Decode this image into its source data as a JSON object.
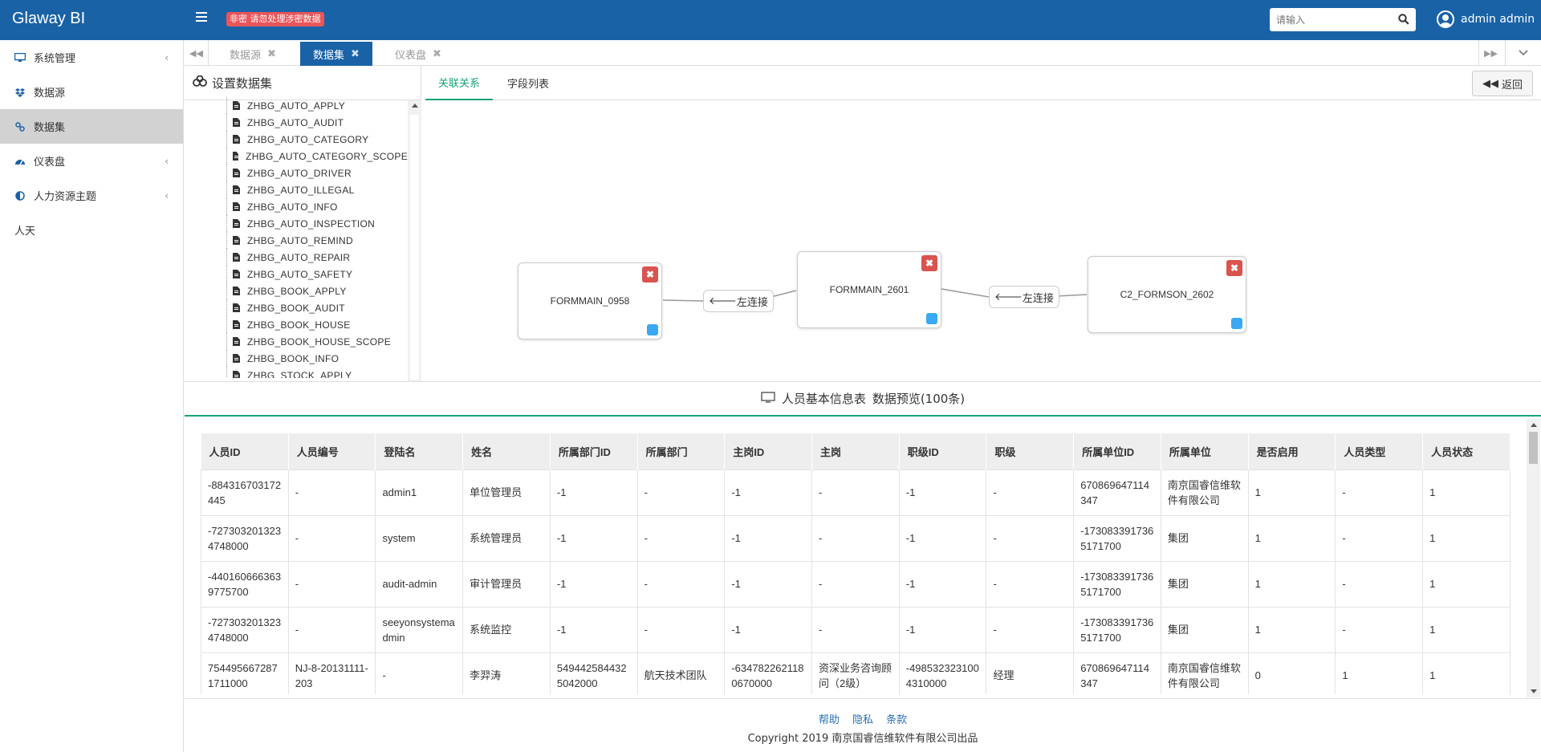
{
  "header": {
    "brand": "Glaway BI",
    "warning_badge": "非密 请忽处理涉密数据",
    "search_placeholder": "请输入",
    "user_name": "admin admin"
  },
  "sidebar": {
    "items": [
      {
        "label": "系统管理",
        "icon": "desktop-icon",
        "has_children": true
      },
      {
        "label": "数据源",
        "icon": "dropbox-icon",
        "has_children": false
      },
      {
        "label": "数据集",
        "icon": "link-icon",
        "has_children": false,
        "active": true
      },
      {
        "label": "仪表盘",
        "icon": "dashboard-icon",
        "has_children": true
      },
      {
        "label": "人力资源主题",
        "icon": "adjust-icon",
        "has_children": true
      },
      {
        "label": "人天",
        "icon": "",
        "has_children": false
      }
    ]
  },
  "tabs": [
    {
      "label": "数据源",
      "active": false
    },
    {
      "label": "数据集",
      "active": true
    },
    {
      "label": "仪表盘",
      "active": false
    }
  ],
  "tree": {
    "title": "设置数据集",
    "nodes": [
      "ZHBG_AUTO_APPLY",
      "ZHBG_AUTO_AUDIT",
      "ZHBG_AUTO_CATEGORY",
      "ZHBG_AUTO_CATEGORY_SCOPE",
      "ZHBG_AUTO_DRIVER",
      "ZHBG_AUTO_ILLEGAL",
      "ZHBG_AUTO_INFO",
      "ZHBG_AUTO_INSPECTION",
      "ZHBG_AUTO_REMIND",
      "ZHBG_AUTO_REPAIR",
      "ZHBG_AUTO_SAFETY",
      "ZHBG_BOOK_APPLY",
      "ZHBG_BOOK_AUDIT",
      "ZHBG_BOOK_HOUSE",
      "ZHBG_BOOK_HOUSE_SCOPE",
      "ZHBG_BOOK_INFO",
      "ZHBG_STOCK_APPLY"
    ]
  },
  "relation": {
    "tabs": [
      "关联关系",
      "字段列表"
    ],
    "back_label": "返回",
    "tables": [
      "FORMMAIN_0958",
      "FORMMAIN_2601",
      "C2_FORMSON_2602"
    ],
    "joins": [
      "左连接",
      "左连接"
    ]
  },
  "preview": {
    "table_name": "人员基本信息表",
    "title": "数据预览(100条)"
  },
  "grid": {
    "columns": [
      "人员ID",
      "人员编号",
      "登陆名",
      "姓名",
      "所属部门ID",
      "所属部门",
      "主岗ID",
      "主岗",
      "职级ID",
      "职级",
      "所属单位ID",
      "所属单位",
      "是否启用",
      "人员类型",
      "人员状态"
    ],
    "rows": [
      [
        "-884316703172445",
        "-",
        "admin1",
        "单位管理员",
        "-1",
        "-",
        "-1",
        "-",
        "-1",
        "-",
        "670869647114347",
        "南京国睿信维软件有限公司",
        "1",
        "-",
        "1"
      ],
      [
        "-7273032013234748000",
        "-",
        "system",
        "系统管理员",
        "-1",
        "-",
        "-1",
        "-",
        "-1",
        "-",
        "-1730833917365171700",
        "集团",
        "1",
        "-",
        "1"
      ],
      [
        "-4401606663639775700",
        "-",
        "audit-admin",
        "审计管理员",
        "-1",
        "-",
        "-1",
        "-",
        "-1",
        "-",
        "-1730833917365171700",
        "集团",
        "1",
        "-",
        "1"
      ],
      [
        "-7273032013234748000",
        "-",
        "seeyonsystemadmin",
        "系统监控",
        "-1",
        "-",
        "-1",
        "-",
        "-1",
        "-",
        "-1730833917365171700",
        "集团",
        "1",
        "-",
        "1"
      ],
      [
        "7544956672871711000",
        "NJ-8-20131111-203",
        "-",
        "李羿涛",
        "5494425844325042000",
        "航天技术团队",
        "-6347822621180670000",
        "资深业务咨询顾问（2级）",
        "-4985323231004310000",
        "经理",
        "670869647114347",
        "南京国睿信维软件有限公司",
        "0",
        "1",
        "1"
      ]
    ]
  },
  "footer": {
    "links": [
      "帮助",
      "隐私",
      "条款"
    ],
    "copyright": "Copyright 2019 南京国睿信维软件有限公司出品"
  },
  "colors": {
    "primary": "#1a62a6",
    "accent": "#1aa37a",
    "danger": "#d9534f",
    "port": "#3aa8f2"
  }
}
